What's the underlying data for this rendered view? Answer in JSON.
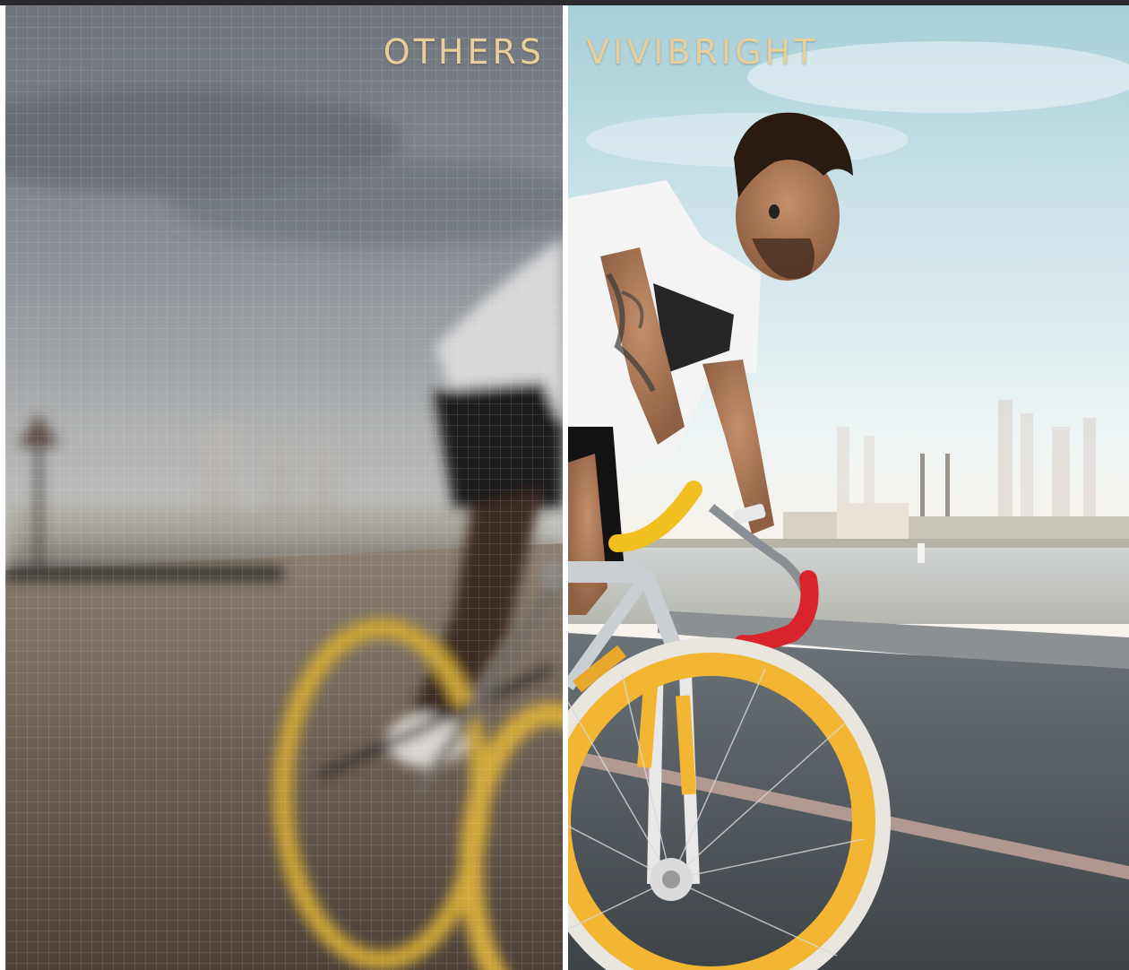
{
  "comparison": {
    "left_label": "OTHERS",
    "right_label": "VIVIBRIGHT"
  },
  "colors": {
    "label_gold": "#e8cf9a",
    "frame_bar": "#2b2b2d",
    "tire_yellow": "#f2b632",
    "grip_red": "#d8242a",
    "grip_yellow": "#f0c020",
    "shirt_white": "#f4f4f4"
  },
  "scene": {
    "subject": "cyclist-on-fixed-gear-bike",
    "setting": "seaside-road-with-city-skyline"
  }
}
